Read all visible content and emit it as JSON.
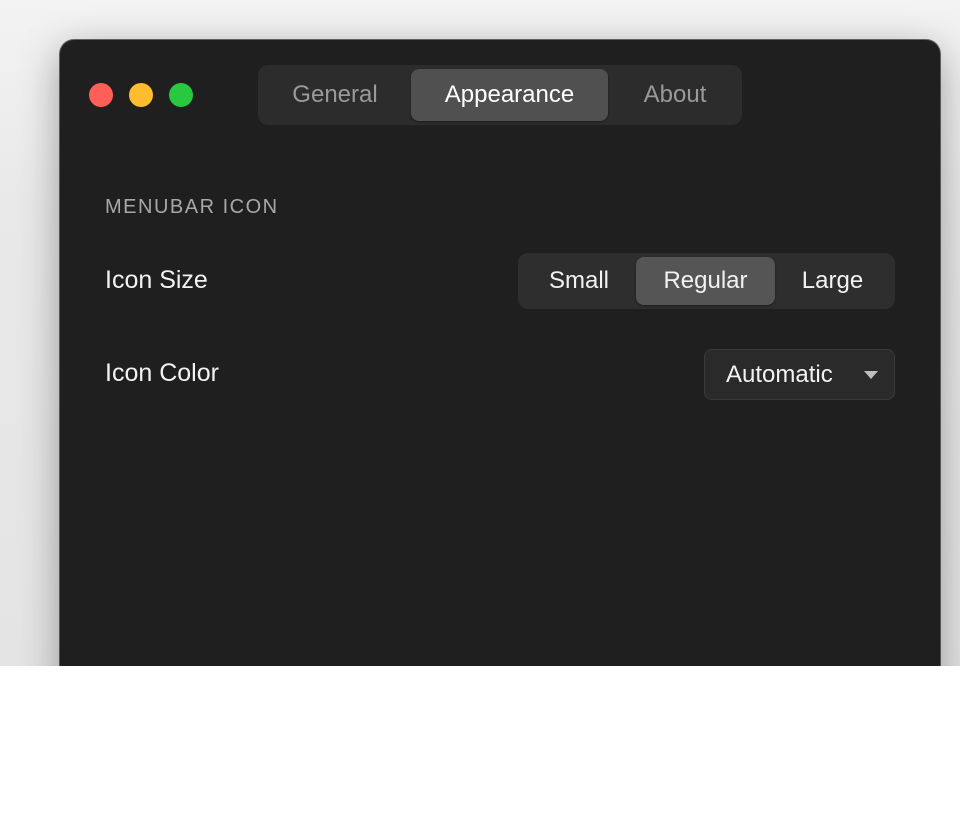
{
  "window": {
    "traffic_lights": [
      {
        "name": "close",
        "color": "#ff5f57"
      },
      {
        "name": "minimize",
        "color": "#febc2e"
      },
      {
        "name": "zoom",
        "color": "#28c840"
      }
    ]
  },
  "tabs": {
    "items": [
      {
        "label": "General",
        "selected": false
      },
      {
        "label": "Appearance",
        "selected": true
      },
      {
        "label": "About",
        "selected": false
      }
    ]
  },
  "section": {
    "title": "MENUBAR ICON"
  },
  "icon_size": {
    "label": "Icon Size",
    "options": [
      "Small",
      "Regular",
      "Large"
    ],
    "selected": "Regular"
  },
  "icon_color": {
    "label": "Icon Color",
    "value": "Automatic",
    "icon": "chevron-down-icon"
  },
  "colors": {
    "window_bg": "#1f1f1f",
    "selected_segment": "#555555",
    "text": "#f2f2f2",
    "muted_text": "#9a9a9a"
  }
}
